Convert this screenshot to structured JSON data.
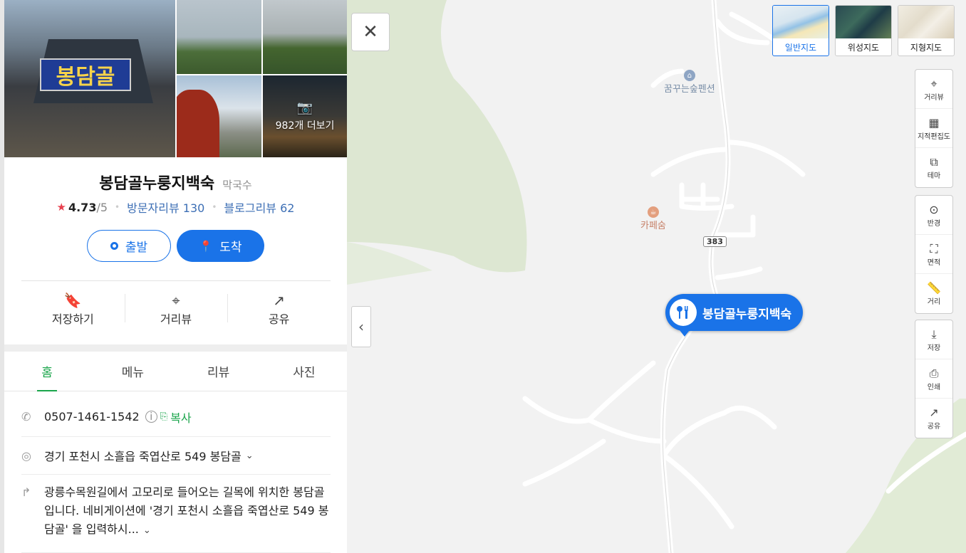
{
  "panel": {
    "photos": {
      "more_label": "982개 더보기",
      "sign_text": "봉담골"
    },
    "place_name": "봉담골누룽지백숙",
    "category": "막국수",
    "rating": {
      "score": "4.73",
      "max": "/5"
    },
    "visitor_reviews": "방문자리뷰 130",
    "blog_reviews": "블로그리뷰 62",
    "route": {
      "start_label": "출발",
      "arrive_label": "도착"
    },
    "actions": [
      {
        "label": "저장하기"
      },
      {
        "label": "거리뷰"
      },
      {
        "label": "공유"
      }
    ],
    "tabs": [
      {
        "label": "홈"
      },
      {
        "label": "메뉴"
      },
      {
        "label": "리뷰"
      },
      {
        "label": "사진"
      }
    ],
    "phone": "0507-1461-1542",
    "copy_label": "복사",
    "address": "경기 포천시 소흘읍 죽엽산로 549 봉담골",
    "directions": "광릉수목원길에서 고모리로 들어오는 길목에 위치한 봉담골입니다. 네비게이션에 '경기 포천시 소흘읍 죽엽산로 549 봉담골' 을 입력하시..."
  },
  "map": {
    "marker_label": "봉담골누룽지백숙",
    "pois": {
      "pension": "꿈꾸는숲펜션",
      "cafe": "카페숨"
    },
    "route_number": "383",
    "map_types": [
      {
        "label": "일반지도",
        "active": true
      },
      {
        "label": "위성지도",
        "active": false
      },
      {
        "label": "지형지도",
        "active": false
      }
    ],
    "tools": {
      "streetview": "거리뷰",
      "cadastral": "지적편집도",
      "theme": "테마",
      "radius": "반경",
      "area": "면적",
      "distance": "거리",
      "save": "저장",
      "print": "인쇄",
      "share": "공유"
    }
  },
  "colors": {
    "accent": "#1a73e8",
    "tab_active": "#1aa54b",
    "star": "#e8404e",
    "link": "#3d6fb5"
  }
}
